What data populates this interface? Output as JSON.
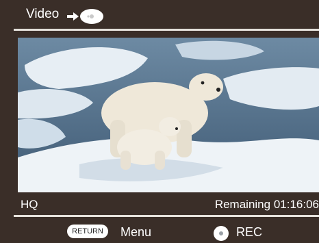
{
  "header": {
    "title": "Video",
    "indicator_icon": "disc-play-icon"
  },
  "player": {
    "quality": "HQ",
    "remaining": "Remaining 01:16:06"
  },
  "footer": {
    "return_label": "RETURN",
    "menu_label": "Menu",
    "rec_label": "REC",
    "rec_icon": "record-button-icon"
  },
  "colors": {
    "background": "#3a2e28",
    "divider": "#e6e2dc",
    "text": "#ffffff"
  }
}
